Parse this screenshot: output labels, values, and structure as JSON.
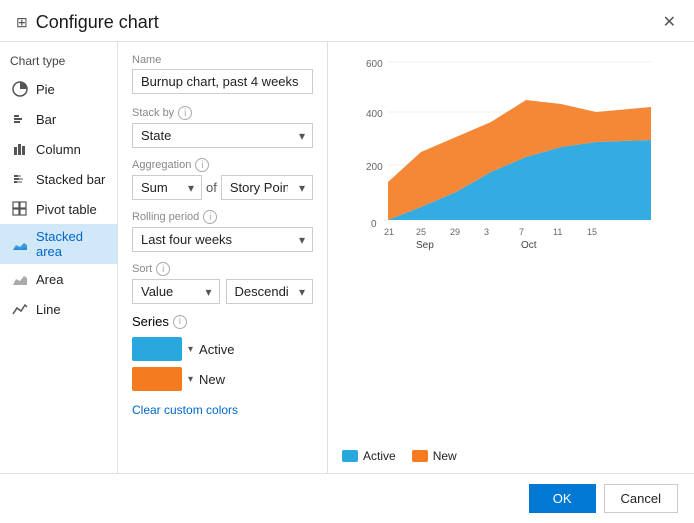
{
  "dialog": {
    "title": "Configure chart",
    "title_icon": "⊞",
    "close_label": "✕"
  },
  "chart_type_label": "Chart type",
  "chart_types": [
    {
      "id": "pie",
      "label": "Pie",
      "icon": "pie"
    },
    {
      "id": "bar",
      "label": "Bar",
      "icon": "bar"
    },
    {
      "id": "column",
      "label": "Column",
      "icon": "column"
    },
    {
      "id": "stacked-bar",
      "label": "Stacked bar",
      "icon": "stacked-bar"
    },
    {
      "id": "pivot-table",
      "label": "Pivot table",
      "icon": "pivot"
    },
    {
      "id": "stacked-area",
      "label": "Stacked area",
      "icon": "stacked-area",
      "active": true
    },
    {
      "id": "area",
      "label": "Area",
      "icon": "area"
    },
    {
      "id": "line",
      "label": "Line",
      "icon": "line"
    }
  ],
  "form": {
    "name_label": "Name",
    "name_value": "Burnup chart, past 4 weeks",
    "stack_by_label": "Stack by",
    "stack_by_value": "State",
    "aggregation_label": "Aggregation",
    "aggregation_func": "Sum",
    "aggregation_of": "of",
    "aggregation_field": "Story Points",
    "rolling_period_label": "Rolling period",
    "rolling_period_value": "Last four weeks",
    "sort_label": "Sort",
    "sort_field": "Value",
    "sort_order": "Descending",
    "series_label": "Series",
    "series": [
      {
        "label": "Active",
        "color": "#29a8e0"
      },
      {
        "label": "New",
        "color": "#f47b20"
      }
    ],
    "clear_custom_colors": "Clear custom colors"
  },
  "chart": {
    "y_labels": [
      "600",
      "400",
      "200",
      "0"
    ],
    "x_labels": [
      "21",
      "25",
      "29",
      "3",
      "7",
      "11",
      "15"
    ],
    "x_groups": [
      "Sep",
      "Oct"
    ]
  },
  "legend": {
    "items": [
      {
        "label": "Active",
        "color": "#29a8e0"
      },
      {
        "label": "New",
        "color": "#f47b20"
      }
    ]
  },
  "footer": {
    "ok_label": "OK",
    "cancel_label": "Cancel"
  }
}
